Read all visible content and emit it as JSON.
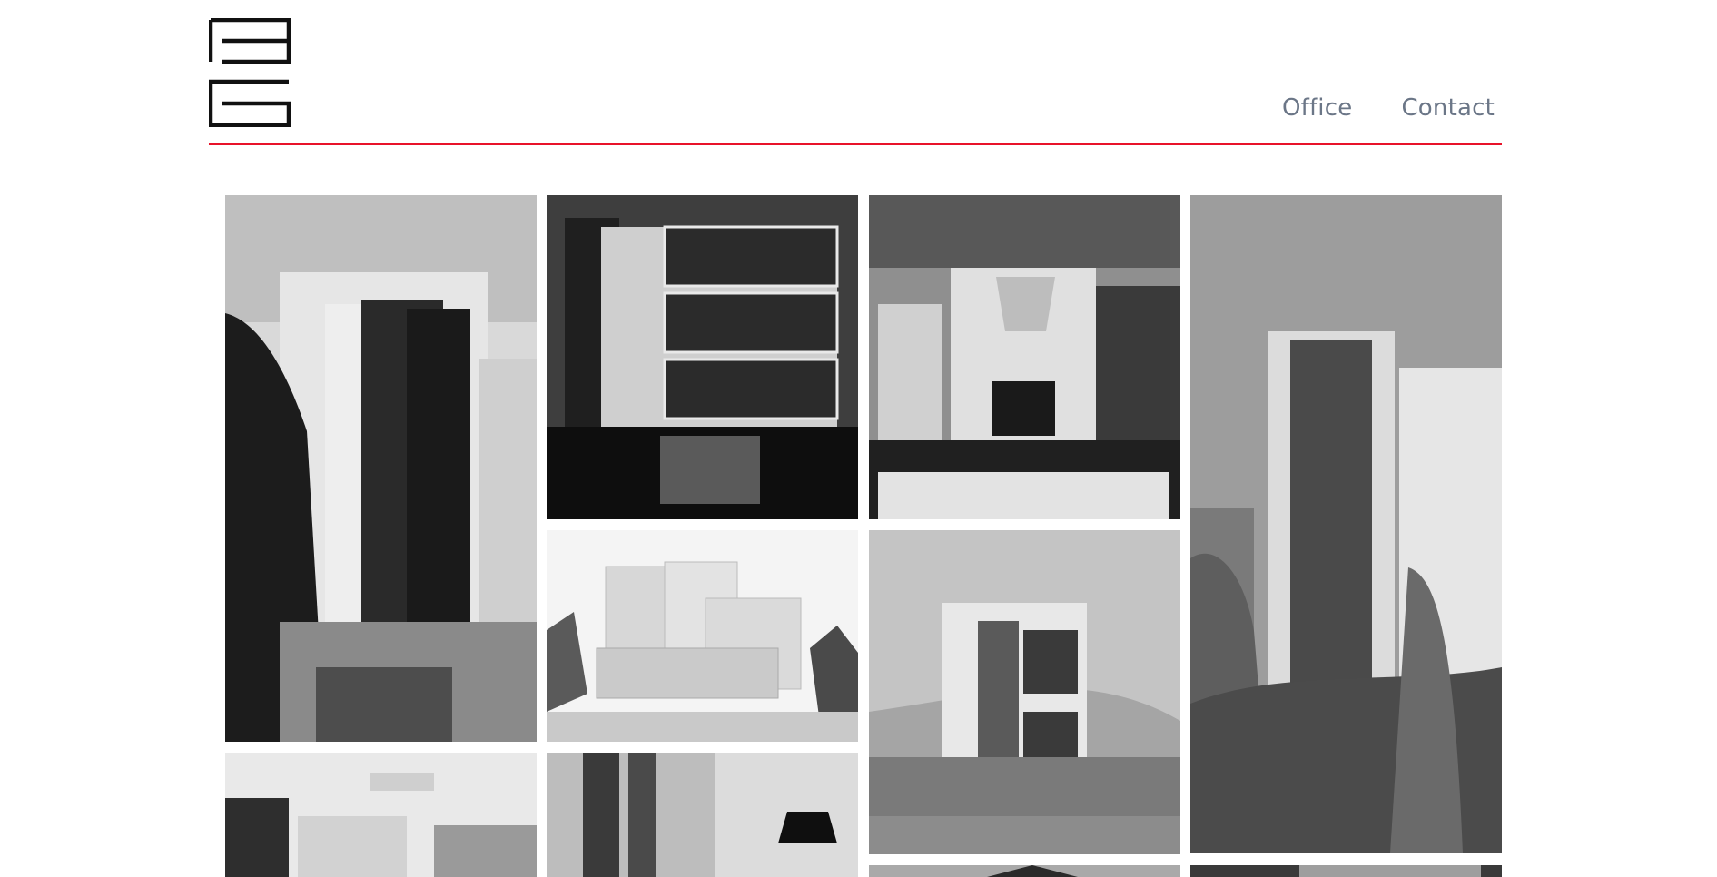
{
  "site": {
    "logo_icon": "bg-monogram-logo",
    "accent_color": "#e8132a",
    "nav": [
      {
        "label": "Office"
      },
      {
        "label": "Contact"
      }
    ]
  },
  "gallery": {
    "tiles": [
      {
        "name": "project-tile-brick-tower"
      },
      {
        "name": "project-tile-night-facade"
      },
      {
        "name": "project-tile-lobby-fireplace"
      },
      {
        "name": "project-tile-highrise-trees"
      },
      {
        "name": "project-tile-glass-cubes-render"
      },
      {
        "name": "project-tile-stacked-boxes-render"
      },
      {
        "name": "project-tile-office-interior"
      },
      {
        "name": "project-tile-dining-interior"
      },
      {
        "name": "project-tile-roof-render"
      },
      {
        "name": "project-tile-dark-interior"
      }
    ]
  }
}
